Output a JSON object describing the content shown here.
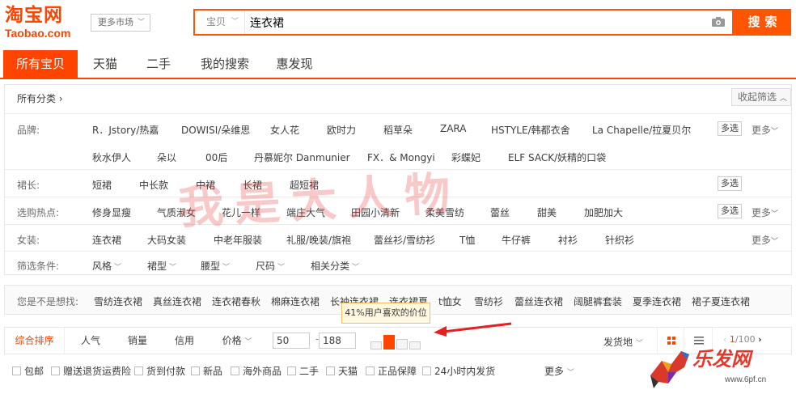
{
  "header": {
    "logo_cn": "淘宝网",
    "logo_en": "Taobao.com",
    "market_label": "更多市场",
    "search_type": "宝贝",
    "search_value": "连衣裙",
    "search_button": "搜索",
    "brand_color": "#ff4400"
  },
  "tabs": [
    "所有宝贝",
    "天猫",
    "二手",
    "我的搜索",
    "惠发现"
  ],
  "filters": {
    "crumb": "所有分类",
    "collapse_label": "收起筛选",
    "brand_label": "品牌:",
    "brand_row1": [
      "R．Jstory/热嘉",
      "DOWISI/朵维思",
      "女人花",
      "欧时力",
      "稻草朵",
      "ZARA",
      "HSTYLE/韩都衣舍",
      "La Chapelle/拉夏贝尔"
    ],
    "brand_row2": [
      "秋水伊人",
      "朵以",
      "00后",
      "丹慕妮尔 Danmunier",
      "FX．& Mongyi",
      "彩蝶妃",
      "ELF SACK/妖精的口袋"
    ],
    "length_label": "裙长:",
    "length_items": [
      "短裙",
      "中长款",
      "中裙",
      "长裙",
      "超短裙"
    ],
    "hot_label": "选购热点:",
    "hot_items": [
      "修身显瘦",
      "气质淑女",
      "花儿一样",
      "端庄大气",
      "田园小清新",
      "柔美雪纺",
      "蕾丝",
      "甜美",
      "加肥加大"
    ],
    "women_label": "女装:",
    "women_items": [
      "连衣裙",
      "大码女装",
      "中老年服装",
      "礼服/晚装/旗袍",
      "蕾丝衫/雪纺衫",
      "T恤",
      "牛仔裤",
      "衬衫",
      "针织衫"
    ],
    "cond_label": "筛选条件:",
    "cond_items": [
      "风格",
      "裙型",
      "腰型",
      "尺码",
      "相关分类"
    ],
    "multi_label": "多选",
    "more_label": "更多"
  },
  "watermark": "我是大人物",
  "suggest": {
    "label": "您是不是想找:",
    "items": [
      "雪纺连衣裙",
      "真丝连衣裙",
      "连衣裙春秋",
      "棉麻连衣裙",
      "长袖连衣裙",
      "连衣裙夏",
      "t恤女",
      "雪纺衫",
      "蕾丝连衣裙",
      "阔腿裤套装",
      "夏季连衣裙",
      "裙子夏连衣裙"
    ]
  },
  "tooltip": "41%用户喜欢的价位",
  "sortbar": {
    "items": [
      "综合排序",
      "人气",
      "销量",
      "信用",
      "价格"
    ],
    "price_min": "50",
    "price_max": "188",
    "price_bar_levels": [
      0.45,
      0.8,
      0.6,
      0.45
    ],
    "location": "发货地",
    "page_current": "1",
    "page_total": "/100"
  },
  "checkboxes": [
    "包邮",
    "赠送退货运费险",
    "货到付款",
    "新品",
    "海外商品",
    "二手",
    "天猫",
    "正品保障",
    "24小时内发货"
  ],
  "checkbox_more": "更多",
  "site_logo": {
    "name": "乐发网",
    "url": "www.6pf.cn"
  }
}
